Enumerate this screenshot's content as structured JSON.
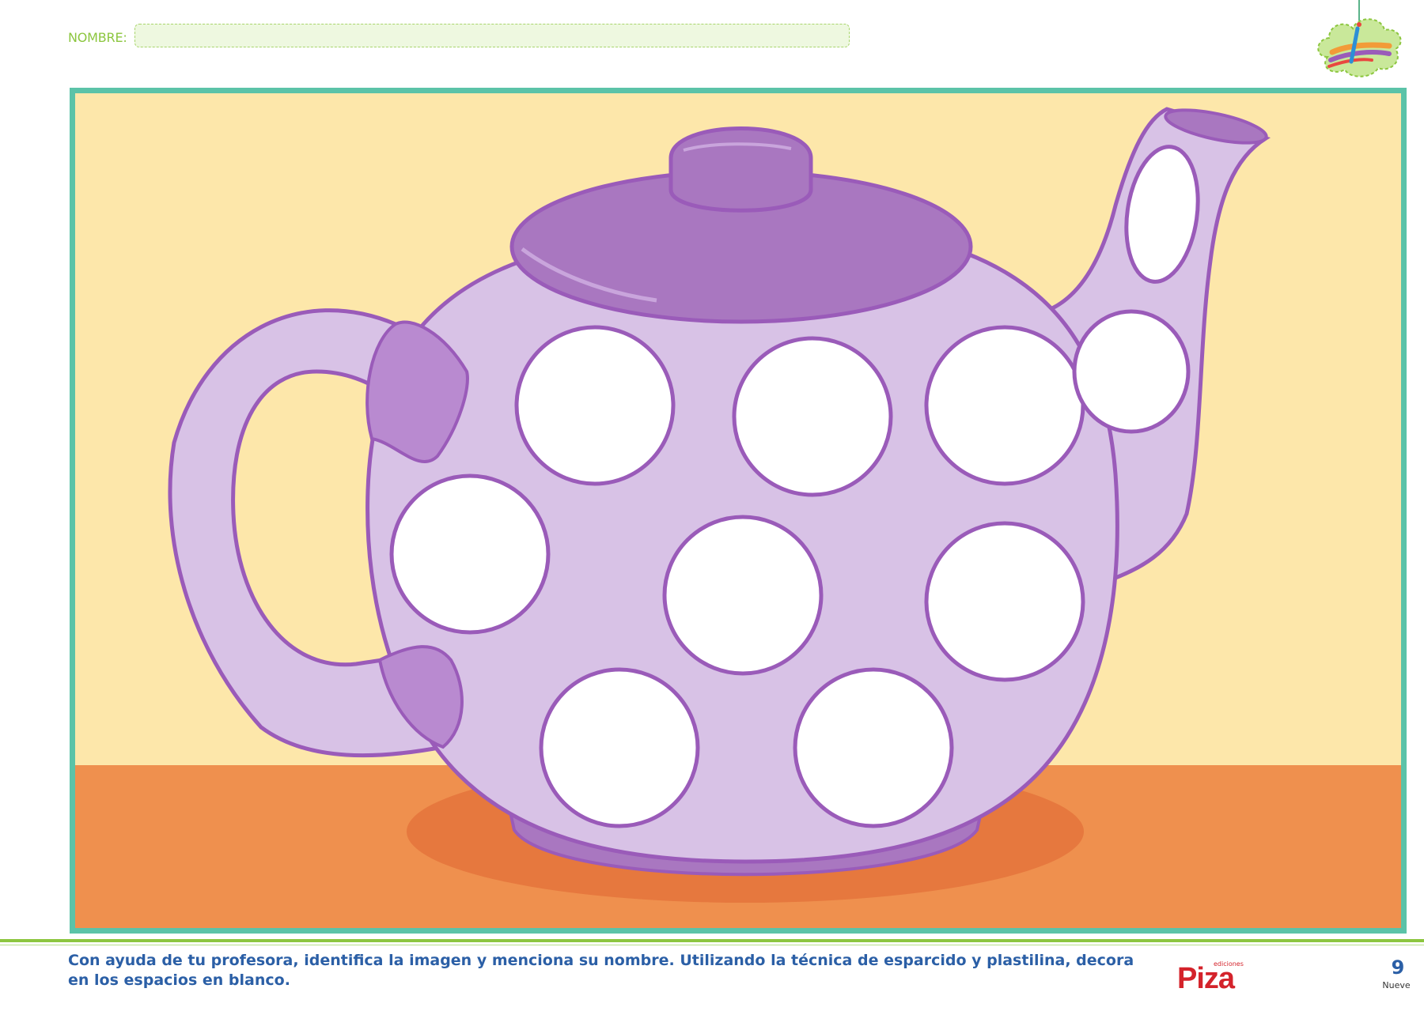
{
  "header": {
    "name_label": "NOMBRE:"
  },
  "illustration": {
    "subject": "teapot",
    "blank_spots": 10,
    "colors": {
      "frame": "#5bc3a8",
      "wall": "#fde7aa",
      "table": "#ef904e",
      "teapot_body": "#d8c2e6",
      "teapot_outline": "#9a5bb9",
      "lid": "#a977c0",
      "spot_fill": "#ffffff"
    }
  },
  "footer": {
    "instruction": "Con ayuda de tu profesora, identifica la imagen y menciona su nombre. Utilizando la técnica de esparcido y plastilina, decora en los espacios en blanco.",
    "publisher_small": "ediciones",
    "publisher_name": "Piza",
    "page_number": "9",
    "page_word": "Nueve"
  }
}
